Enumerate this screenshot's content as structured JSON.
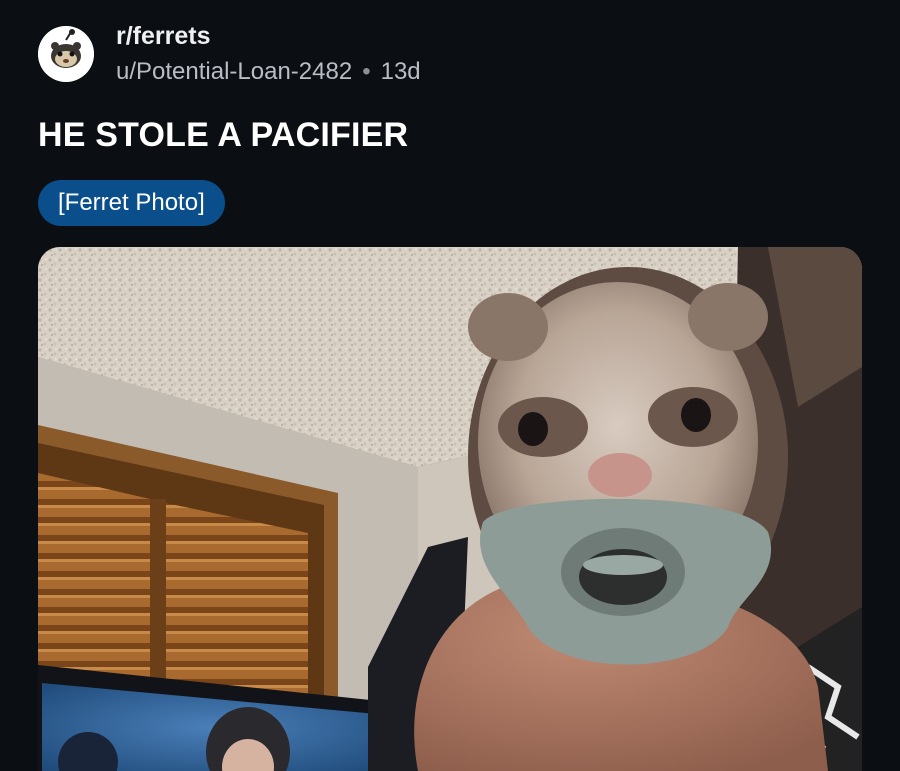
{
  "post": {
    "subreddit": "r/ferrets",
    "author": "u/Potential-Loan-2482",
    "separator": "•",
    "age": "13d",
    "title": "HE STOLE A PACIFIER",
    "flair": "[Ferret Photo]"
  },
  "icons": {
    "avatar": "subreddit-avatar-icon"
  },
  "colors": {
    "background": "#0b0e13",
    "flair_background": "#0a4f8c",
    "text_primary": "#ffffff",
    "text_secondary": "#b9bec5"
  }
}
